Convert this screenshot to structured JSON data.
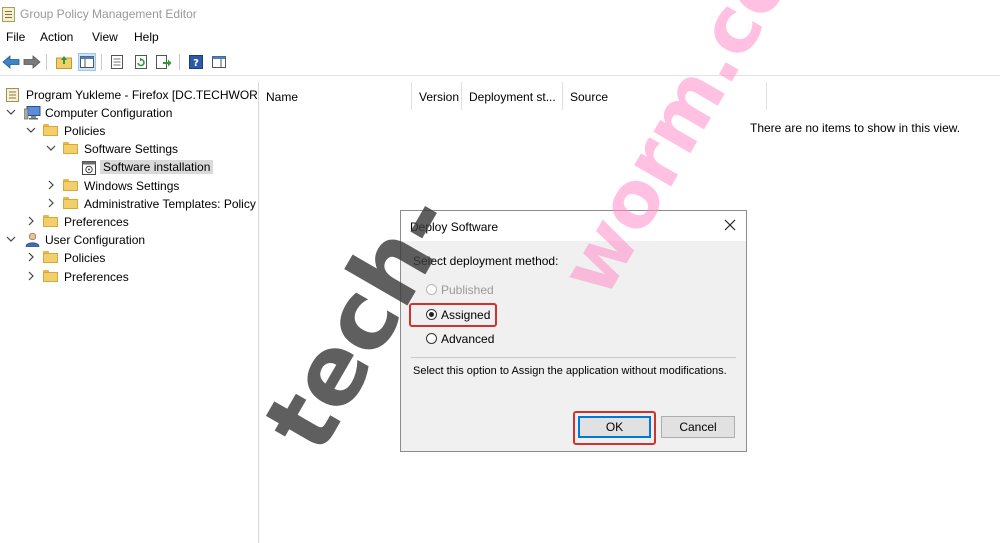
{
  "window": {
    "title": "Group Policy Management Editor"
  },
  "menu": [
    "File",
    "Action",
    "View",
    "Help"
  ],
  "toolbar": {
    "icons": [
      "back-arrow-icon",
      "forward-arrow-icon",
      "up-folder-icon",
      "show-hide-tree-icon",
      "properties-icon",
      "refresh-icon",
      "export-list-icon",
      "help-icon",
      "show-hide-action-pane-icon"
    ]
  },
  "tree": {
    "root": "Program Yukleme - Firefox [DC.TECHWOR",
    "computer_config": "Computer Configuration",
    "policies": "Policies",
    "software_settings": "Software Settings",
    "software_installation": "Software installation",
    "windows_settings": "Windows Settings",
    "admin_templates": "Administrative Templates: Policy",
    "preferences": "Preferences",
    "user_config": "User Configuration",
    "user_policies": "Policies",
    "user_preferences": "Preferences"
  },
  "list": {
    "columns": [
      "Name",
      "Version",
      "Deployment st...",
      "Source"
    ],
    "empty_message": "There are no items to show in this view."
  },
  "dialog": {
    "title": "Deploy Software",
    "prompt": "Select deployment method:",
    "options": [
      {
        "label": "Published",
        "state": "disabled"
      },
      {
        "label": "Assigned",
        "state": "selected"
      },
      {
        "label": "Advanced",
        "state": "unselected"
      }
    ],
    "description": "Select this option to Assign the application without modifications.",
    "ok_label": "OK",
    "cancel_label": "Cancel"
  },
  "watermark": {
    "dark": "tech-",
    "pink": "worm.com"
  },
  "colors": {
    "highlight_red": "#d0332f",
    "selection_blue": "#0078d7",
    "folder_yellow": "#f3cf6b"
  }
}
